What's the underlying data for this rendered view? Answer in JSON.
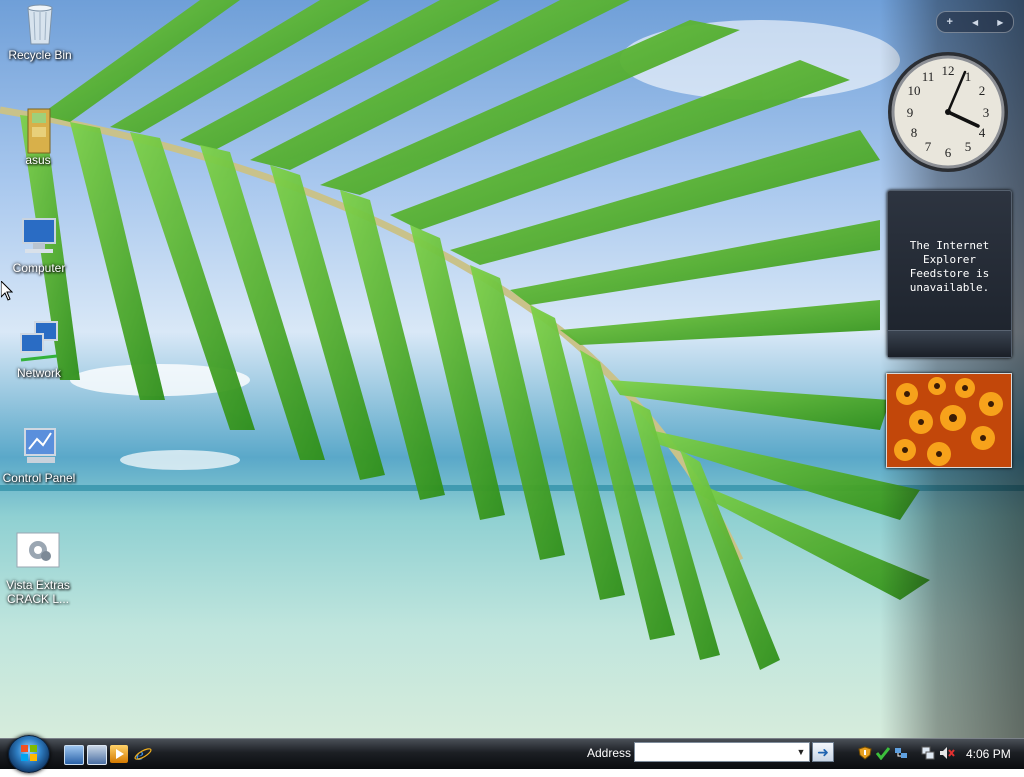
{
  "desktop": {
    "icons": [
      {
        "label": "Recycle Bin",
        "icon": "recycle-bin-icon"
      },
      {
        "label": "asus",
        "icon": "folder-icon"
      },
      {
        "label": "Computer",
        "icon": "computer-icon"
      },
      {
        "label": "Network",
        "icon": "network-icon"
      },
      {
        "label": "Control Panel",
        "icon": "control-panel-icon"
      },
      {
        "label": "Vista Extras CRACK L...",
        "label_line1": "Vista Extras",
        "label_line2": "CRACK L...",
        "icon": "settings-gear-icon"
      }
    ]
  },
  "sidebar": {
    "controls": {
      "add": "+",
      "prev": "◀",
      "next": "▶"
    },
    "clock": {
      "numbers": [
        "12",
        "1",
        "2",
        "3",
        "4",
        "5",
        "6",
        "7",
        "8",
        "9",
        "10",
        "11"
      ],
      "time": "4:06"
    },
    "feed": {
      "message_line1": "The Internet Explorer",
      "message_line2": "Feedstore is",
      "message_line3": "unavailable."
    }
  },
  "taskbar": {
    "start": "start-orb-icon",
    "quicklaunch": [
      "show-desktop-icon",
      "switch-windows-icon",
      "media-player-icon",
      "internet-explorer-icon"
    ],
    "address_label": "Address",
    "address_value": "",
    "go_icon": "go-arrow-icon",
    "tray": [
      "security-shield-icon",
      "defender-check-icon",
      "network-connection-icon",
      "network-status-icon",
      "volume-muted-icon"
    ],
    "clock": "4:06 PM"
  },
  "colors": {
    "taskbar": "#1c1f24",
    "palm": "#4fb82a",
    "sky": "#6f9fd8",
    "sea": "#8fd0d2"
  }
}
